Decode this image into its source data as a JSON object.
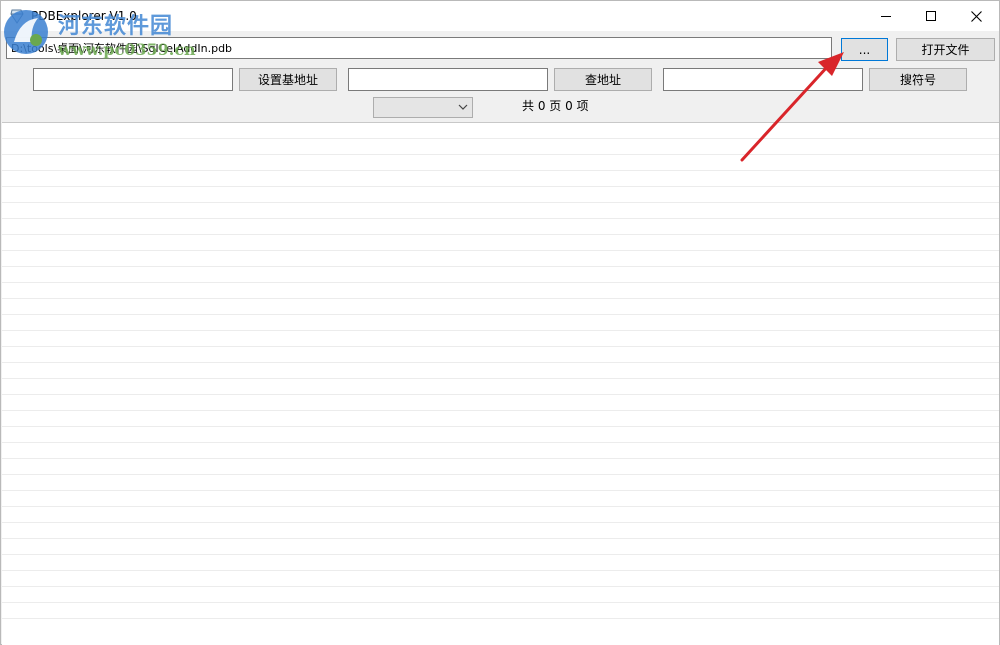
{
  "window": {
    "title": "PDBExplorer V1.0",
    "minimize_icon": "minimize-icon",
    "maximize_icon": "maximize-icon",
    "close_icon": "close-icon"
  },
  "watermark": {
    "text_cn": "河东软件园",
    "url": "www.pc0359.cn"
  },
  "toolbar": {
    "path_value": "D:\\tools\\桌面\\河东软件园\\SqlCelAddIn.pdb",
    "browse_label": "...",
    "open_file_label": "打开文件",
    "base_address_value": "",
    "set_base_label": "设置基地址",
    "address_value": "",
    "lookup_address_label": "查地址",
    "symbol_value": "",
    "search_symbol_label": "搜符号",
    "page_select_value": "",
    "page_info": "共 0 页 0 项"
  },
  "list": {
    "row_count": 31,
    "rows": []
  },
  "colors": {
    "annotation_arrow": "#d9252a",
    "focus_border": "#0078d7",
    "watermark_blue": "#4d8ed6",
    "watermark_green": "#6aa84f"
  }
}
